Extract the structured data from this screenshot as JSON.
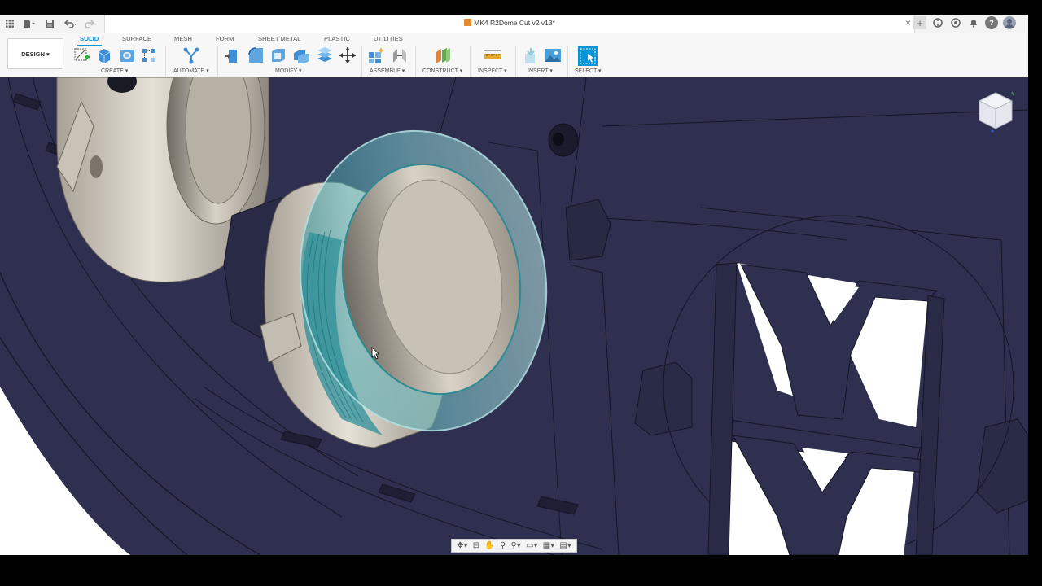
{
  "document": {
    "title": "MK4 R2Dome Cut v2 v13*"
  },
  "quick_access": {
    "grid_icon": "app-grid-icon",
    "file_icon": "file-icon",
    "save_icon": "save-icon",
    "undo_icon": "undo-icon",
    "redo_icon": "redo-icon"
  },
  "header_icons": [
    "new-tab-icon",
    "extensions-icon",
    "job-status-icon",
    "notifications-icon",
    "help-icon",
    "user-avatar-icon"
  ],
  "workspace": {
    "label": "DESIGN"
  },
  "tabs": [
    "SOLID",
    "SURFACE",
    "MESH",
    "FORM",
    "SHEET METAL",
    "PLASTIC",
    "UTILITIES"
  ],
  "active_tab": "SOLID",
  "groups": {
    "create": "CREATE",
    "automate": "AUTOMATE",
    "modify": "MODIFY",
    "assemble": "ASSEMBLE",
    "construct": "CONSTRUCT",
    "inspect": "INSPECT",
    "insert": "INSERT",
    "select": "SELECT"
  },
  "colors": {
    "accent": "#0696d7",
    "model_body": "#2f3050",
    "model_edge": "#151525",
    "metal": "#cbc4b8",
    "translucent_ring": "#8fd3d6",
    "background": "#ffffff"
  }
}
